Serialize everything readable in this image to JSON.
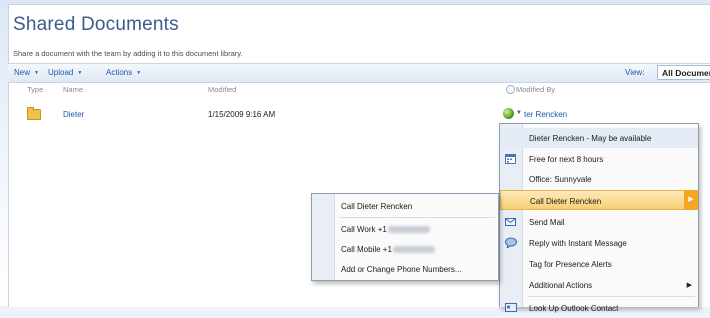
{
  "page": {
    "title": "Shared Documents",
    "description": "Share a document with the team by adding it to this document library."
  },
  "toolbar": {
    "new_label": "New",
    "upload_label": "Upload",
    "actions_label": "Actions",
    "view_label": "View:",
    "view_value": "All Documents"
  },
  "columns": {
    "type": "Type",
    "name": "Name",
    "modified": "Modified",
    "modified_by": "Modified By"
  },
  "rows": [
    {
      "name": "Dieter",
      "modified": "1/15/2009 9:16 AM",
      "modified_by": "ter Rencken"
    }
  ],
  "presence_menu": {
    "header": "Dieter Rencken - May be available",
    "free": "Free for next 8 hours",
    "office": "Office: Sunnyvale",
    "call": "Call Dieter Rencken",
    "send_mail": "Send Mail",
    "reply_im": "Reply with Instant Message",
    "tag_alerts": "Tag for Presence Alerts",
    "additional": "Additional Actions",
    "lookup": "Look Up Outlook Contact"
  },
  "call_menu": {
    "call_name": "Call Dieter Rencken",
    "call_work": "Call Work +1",
    "call_mobile": "Call Mobile +1",
    "add_phone": "Add or Change Phone Numbers..."
  },
  "colors": {
    "accent": "#3d5a8c",
    "link": "#1d5aa8",
    "highlight": "#f9cf76"
  }
}
